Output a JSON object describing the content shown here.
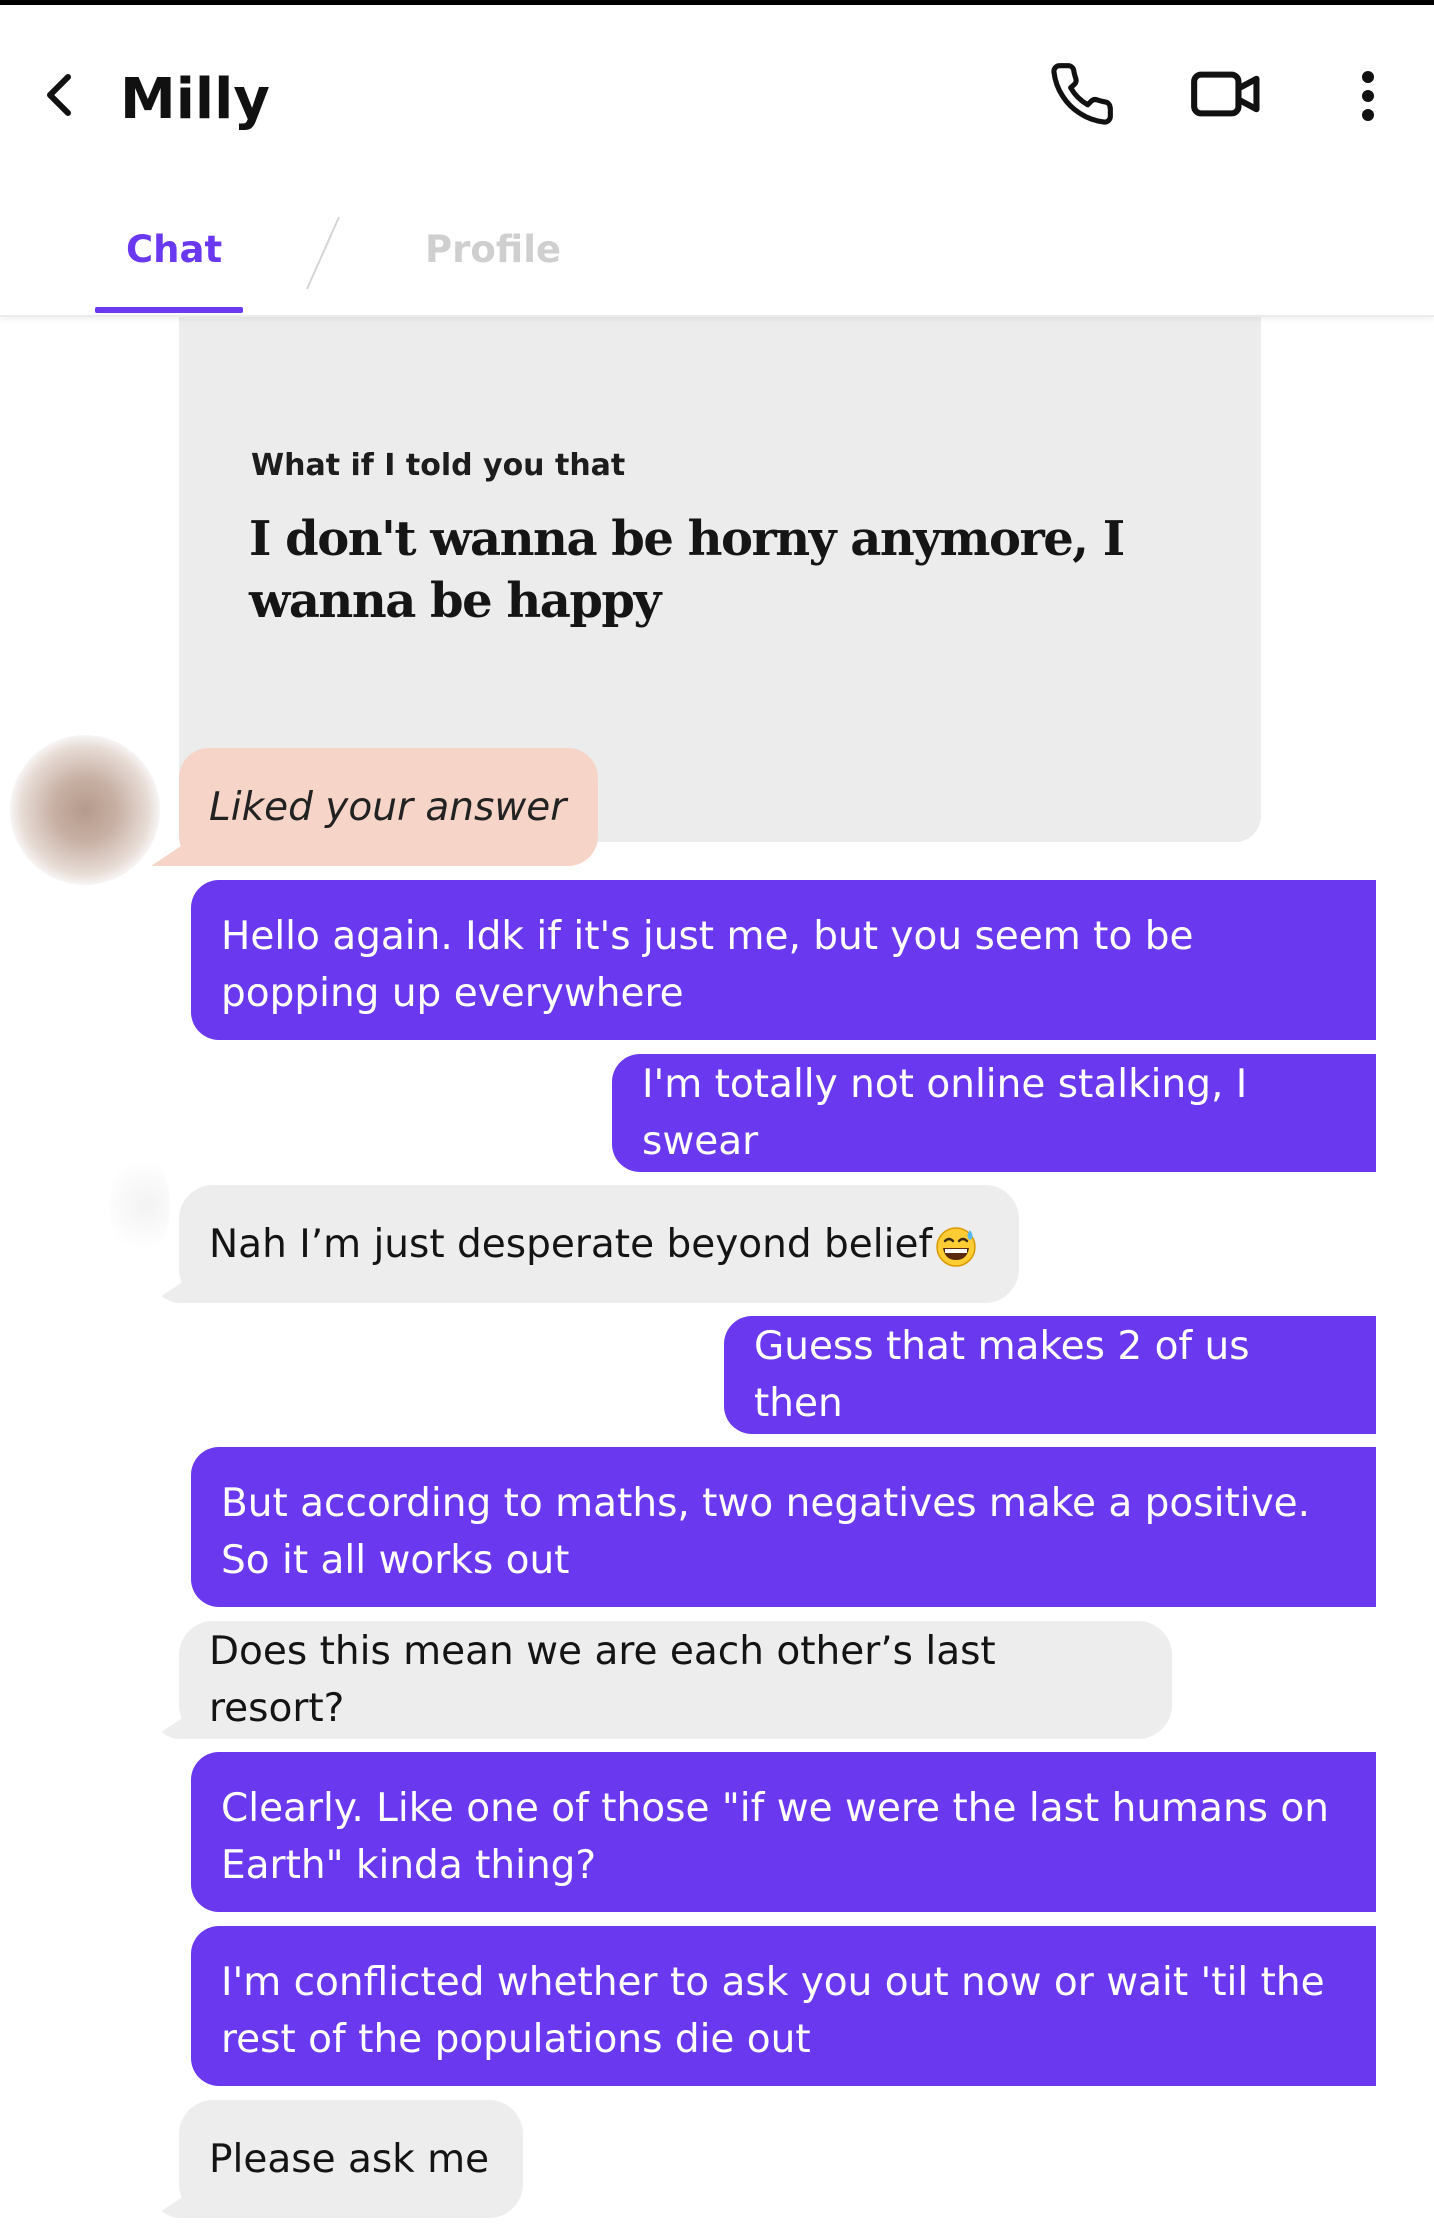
{
  "header": {
    "contact_name": "Milly",
    "icons": [
      "back-chevron-icon",
      "phone-icon",
      "video-call-icon",
      "more-vertical-icon"
    ]
  },
  "tabs": [
    {
      "label": "Chat",
      "active": true
    },
    {
      "label": "Profile",
      "active": false
    }
  ],
  "prompt": {
    "question": "What if I told you that",
    "answer": "I don't wanna be horny anymore, I wanna be happy"
  },
  "messages": [
    {
      "sender": "them",
      "type": "like",
      "text": "Liked your answer"
    },
    {
      "sender": "me",
      "text": "Hello again. Idk if it's just me, but you seem to be popping up everywhere"
    },
    {
      "sender": "me",
      "text": "I'm totally not online stalking, I swear"
    },
    {
      "sender": "them",
      "text": "Nah I’m just desperate beyond belief",
      "emoji": "grinning-sweat-emoji"
    },
    {
      "sender": "me",
      "text": "Guess that makes 2 of us then"
    },
    {
      "sender": "me",
      "text": "But according to maths, two negatives make a positive. So it all works out"
    },
    {
      "sender": "them",
      "text": "Does this mean we are each other’s last resort?"
    },
    {
      "sender": "me",
      "text": "Clearly. Like one of those \"if we were the last humans on Earth\" kinda thing?"
    },
    {
      "sender": "me",
      "text": "I'm conflicted whether  to ask you out now or wait 'til the rest of the populations die out"
    },
    {
      "sender": "them",
      "text": "Please ask me"
    }
  ],
  "colors": {
    "accent": "#6a39ef",
    "incoming_bubble": "#ededed",
    "like_bubble": "#f6d5c8",
    "prompt_card": "#ececec",
    "inactive_tab": "#cfcfcf"
  }
}
